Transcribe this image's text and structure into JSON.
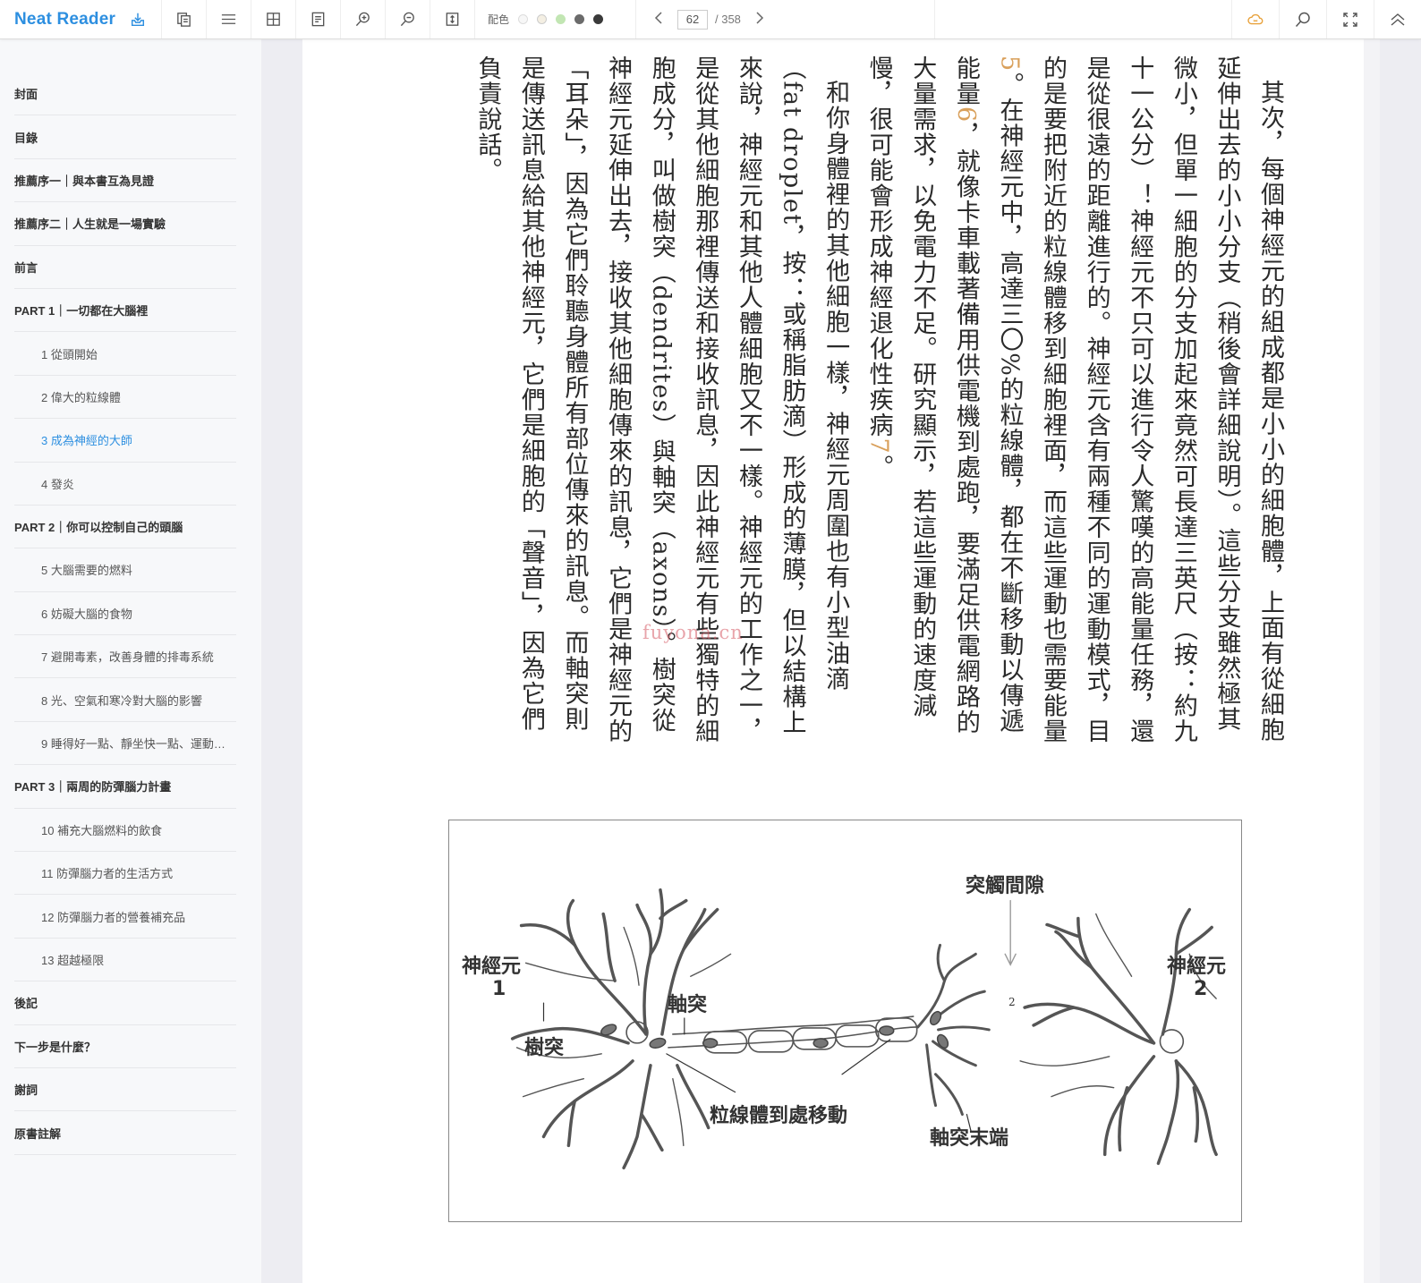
{
  "app": {
    "name": "Neat Reader"
  },
  "toolbar": {
    "buttons": [
      {
        "name": "save-to-cloud",
        "icon": "download-tray-icon"
      },
      {
        "name": "copy",
        "icon": "copy-icon"
      },
      {
        "name": "toc",
        "icon": "menu-icon"
      },
      {
        "name": "layout",
        "icon": "grid-icon"
      },
      {
        "name": "notes",
        "icon": "document-icon"
      },
      {
        "name": "zoom-in",
        "icon": "zoom-in-icon"
      },
      {
        "name": "zoom-out",
        "icon": "zoom-out-icon"
      },
      {
        "name": "fit-height",
        "icon": "fit-height-icon"
      }
    ],
    "color_label": "配色",
    "color_swatches": [
      "#f7f7f7",
      "#f4efe3",
      "#c2e6b3",
      "#6b6b6b",
      "#3a3a3a"
    ],
    "page_current": "62",
    "page_total": "/ 358",
    "right_buttons": [
      {
        "name": "cloud-sync",
        "icon": "cloud-icon",
        "color": "#e8a13a"
      },
      {
        "name": "search",
        "icon": "search-icon"
      },
      {
        "name": "fullscreen",
        "icon": "fullscreen-icon"
      },
      {
        "name": "collapse",
        "icon": "double-chevron-up-icon"
      }
    ]
  },
  "accent_color": "#2d8fe0",
  "toc": [
    {
      "label": "封面",
      "level": 0
    },
    {
      "label": "目錄",
      "level": 0
    },
    {
      "label": "推薦序一｜與本書互為見證",
      "level": 0
    },
    {
      "label": "推薦序二｜人生就是一場實驗",
      "level": 0
    },
    {
      "label": "前言",
      "level": 0
    },
    {
      "label": "PART 1｜一切都在大腦裡",
      "level": 0
    },
    {
      "label": "1 從頭開始",
      "level": 1
    },
    {
      "label": "2 偉大的粒線體",
      "level": 1
    },
    {
      "label": "3 成為神經的大師",
      "level": 1,
      "active": true
    },
    {
      "label": "4 發炎",
      "level": 1
    },
    {
      "label": "PART 2｜你可以控制自己的頭腦",
      "level": 0
    },
    {
      "label": "5 大腦需要的燃料",
      "level": 1
    },
    {
      "label": "6 妨礙大腦的食物",
      "level": 1
    },
    {
      "label": "7 避開毒素，改善身體的排毒系統",
      "level": 1
    },
    {
      "label": "8 光、空氣和寒冷對大腦的影響",
      "level": 1
    },
    {
      "label": "9 睡得好一點、靜坐快一點、運動…",
      "level": 1
    },
    {
      "label": "PART 3｜兩周的防彈腦力計畫",
      "level": 0
    },
    {
      "label": "10 補充大腦燃料的飲食",
      "level": 1
    },
    {
      "label": "11 防彈腦力者的生活方式",
      "level": 1
    },
    {
      "label": "12 防彈腦力者的營養補充品",
      "level": 1
    },
    {
      "label": "13 超越極限",
      "level": 1
    },
    {
      "label": "後記",
      "level": 0
    },
    {
      "label": "下一步是什麼？",
      "level": 0
    },
    {
      "label": "謝詞",
      "level": 0
    },
    {
      "label": "原書註解",
      "level": 0
    }
  ],
  "content": {
    "p1_a": "其次，每個神經元的組成都是小小的細胞體，上面有從細胞延伸出去的小小分支（稍後會詳細說明）。這些分支雖然極其微小，但單一細胞的分支加起來竟然可長達三英尺（按：約九十一公分）！神經元不只可以進行令人驚嘆的高能量任務，還是從很遠的距離進行的。神經元含有兩種不同的運動模式，目的是要把附近的粒線體移到細胞裡面，而這些運動也需要能量",
    "fn5": "5",
    "p1_b": "。在神經元中，高達三〇%的粒線體，都在不斷移動以傳遞能量",
    "fn6": "6",
    "p1_c": "，就像卡車載著備用供電機到處跑，要滿足供電網路的大量需求，以免電力不足。研究顯示，若這些運動的速度減慢，很可能會形成神經退化性疾病",
    "fn7": "7",
    "p1_d": "。",
    "p2": "和你身體裡的其他細胞一樣，神經元周圍也有小型油滴（fat droplet，按：或稱脂肪滴）形成的薄膜，但以結構上來說，神經元和其他人體細胞又不一樣。神經元的工作之一，是從其他細胞那裡傳送和接收訊息，因此神經元有些獨特的細胞成分，叫做樹突（dendrites）與軸突（axons）。樹突從神經元延伸出去，接收其他細胞傳來的訊息，它們是神經元的「耳朵」，因為它們聆聽身體所有部位傳來的訊息。而軸突則是傳送訊息給其他神經元，它們是細胞的「聲音」，因為它們負責說話。"
  },
  "watermark": "fuyona.cn",
  "figure": {
    "labels": {
      "neuron1": "神經元",
      "neuron1_num": "1",
      "dendrite": "樹突",
      "axon": "軸突",
      "mito_moving": "粒線體到處移動",
      "synapse_gap": "突觸間隙",
      "axon_terminal": "軸突末端",
      "neuron2": "神經元",
      "neuron2_num": "2",
      "small_num": "2"
    }
  }
}
